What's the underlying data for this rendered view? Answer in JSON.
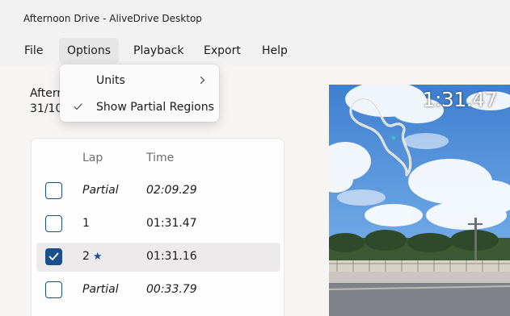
{
  "window": {
    "title": "Afternoon Drive - AliveDrive Desktop"
  },
  "menubar": {
    "items": [
      {
        "label": "File"
      },
      {
        "label": "Options"
      },
      {
        "label": "Playback"
      },
      {
        "label": "Export"
      },
      {
        "label": "Help"
      }
    ]
  },
  "options_menu": {
    "units_label": "Units",
    "show_partial_label": "Show Partial Regions",
    "show_partial_checked": true
  },
  "session": {
    "title_visible": "Aftern",
    "date_visible": "31/10"
  },
  "laps": {
    "headers": {
      "lap": "Lap",
      "time": "Time"
    },
    "rows": [
      {
        "lap": "Partial",
        "time": "02:09.29",
        "partial": true,
        "checked": false,
        "best": false
      },
      {
        "lap": "1",
        "time": "01:31.47",
        "partial": false,
        "checked": false,
        "best": false
      },
      {
        "lap": "2",
        "time": "01:31.16",
        "partial": false,
        "checked": true,
        "best": true
      },
      {
        "lap": "Partial",
        "time": "00:33.79",
        "partial": true,
        "checked": false,
        "best": false
      }
    ],
    "best_marker": "★"
  },
  "video": {
    "overlay_time": "1:31.47"
  },
  "colors": {
    "accent": "#1c4f8a",
    "sky": "#4f8fd6"
  }
}
